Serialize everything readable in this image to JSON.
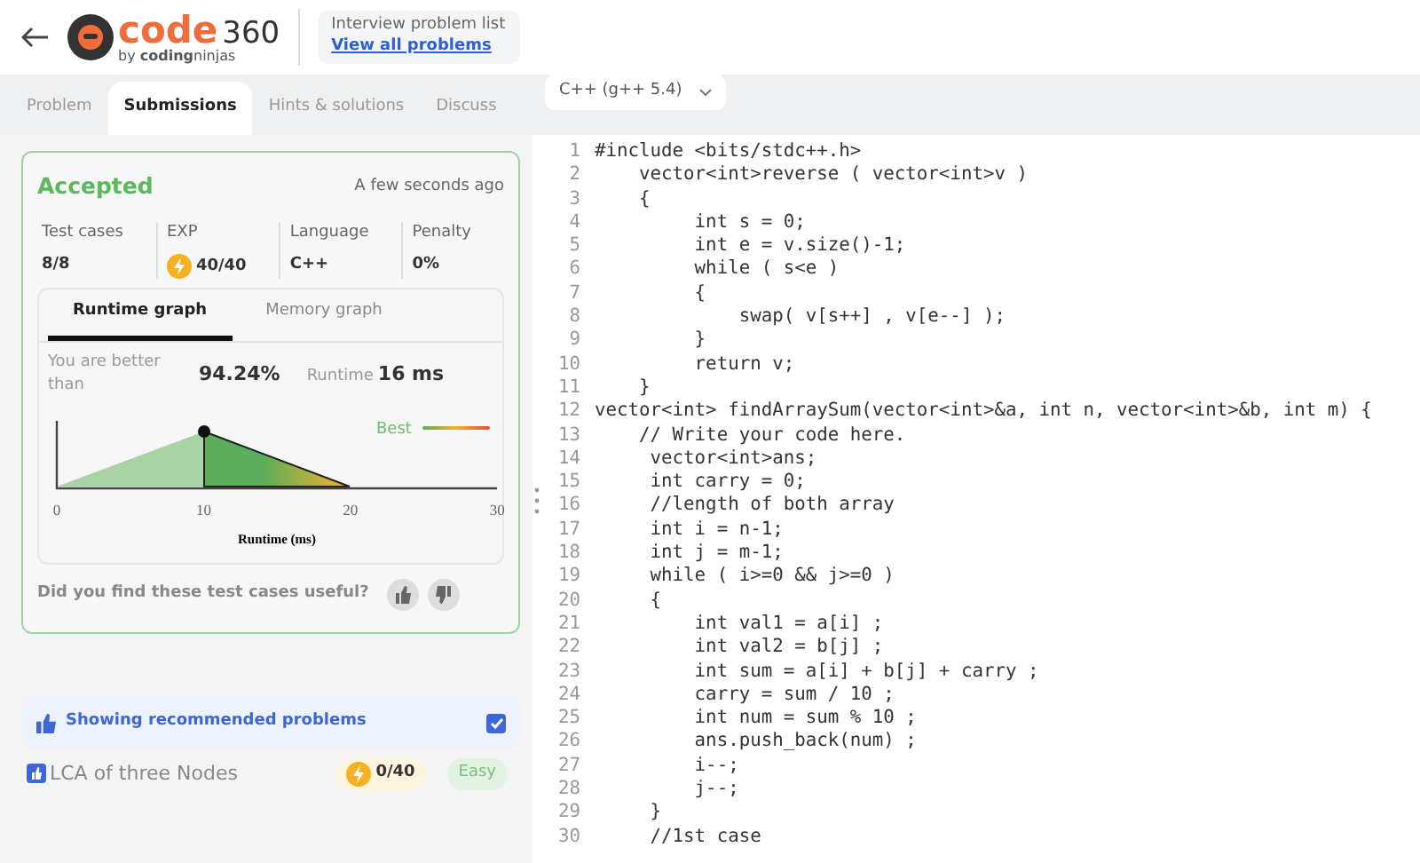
{
  "header": {
    "logo_word": "code",
    "logo_number": "360",
    "logo_by": "by",
    "logo_brand_bold": "coding",
    "logo_brand_light": "ninjas",
    "breadcrumb": "Interview problem list",
    "link": "View all problems"
  },
  "tabs": [
    {
      "label": "Problem",
      "selected": false
    },
    {
      "label": "Submissions",
      "selected": true
    },
    {
      "label": "Hints & solutions",
      "selected": false
    },
    {
      "label": "Discuss",
      "selected": false
    }
  ],
  "submission": {
    "status": "Accepted",
    "time": "A few seconds ago",
    "stats": [
      {
        "label": "Test cases",
        "value": "8/8",
        "kind": "plain"
      },
      {
        "label": "EXP",
        "value": "40/40",
        "kind": "exp"
      },
      {
        "label": "Language",
        "value": "C++",
        "kind": "plain"
      },
      {
        "label": "Penalty",
        "value": "0%",
        "kind": "plain"
      }
    ],
    "graph_tabs": [
      {
        "label": "Runtime graph",
        "selected": true
      },
      {
        "label": "Memory graph",
        "selected": false
      }
    ],
    "better_label": "You are better than",
    "better_value": "94.24%",
    "runtime_label": "Runtime",
    "runtime_value": "16 ms",
    "runtime_chart": {
      "legend": "Best",
      "xticks": [
        "0",
        "10",
        "20",
        "30"
      ],
      "xlabel": "Runtime (ms)"
    },
    "feedback": "Did you find these test cases useful?"
  },
  "recommended": {
    "label": "Showing recommended problems",
    "checked": true
  },
  "problems": [
    {
      "title": "LCA of three Nodes",
      "exp": "0/40",
      "difficulty": "Easy"
    }
  ],
  "editor": {
    "language": "C++ (g++ 5.4)",
    "lines": [
      {
        "number": "1",
        "text": "#include <bits/stdc++.h>"
      },
      {
        "number": "2",
        "text": "    vector<int>reverse ( vector<int>v )"
      },
      {
        "number": "3",
        "text": "    {"
      },
      {
        "number": "4",
        "text": "         int s = 0;"
      },
      {
        "number": "5",
        "text": "         int e = v.size()-1;"
      },
      {
        "number": "6",
        "text": "         while ( s<e )"
      },
      {
        "number": "7",
        "text": "         {"
      },
      {
        "number": "8",
        "text": "             swap( v[s++] , v[e--] );"
      },
      {
        "number": "9",
        "text": "         }"
      },
      {
        "number": "10",
        "text": "         return v;"
      },
      {
        "number": "11",
        "text": "    }"
      },
      {
        "number": "12",
        "text": "vector<int> findArraySum(vector<int>&a, int n, vector<int>&b, int m) {"
      },
      {
        "number": "13",
        "text": "    // Write your code here."
      },
      {
        "number": "14",
        "text": "     vector<int>ans;"
      },
      {
        "number": "15",
        "text": "     int carry = 0;"
      },
      {
        "number": "16",
        "text": "     //length of both array"
      },
      {
        "number": "17",
        "text": "     int i = n-1;"
      },
      {
        "number": "18",
        "text": "     int j = m-1;"
      },
      {
        "number": "19",
        "text": "     while ( i>=0 && j>=0 )"
      },
      {
        "number": "20",
        "text": "     {"
      },
      {
        "number": "21",
        "text": "         int val1 = a[i] ;"
      },
      {
        "number": "22",
        "text": "         int val2 = b[j] ;"
      },
      {
        "number": "23",
        "text": "         int sum = a[i] + b[j] + carry ;"
      },
      {
        "number": "24",
        "text": "         carry = sum / 10 ;"
      },
      {
        "number": "25",
        "text": "         int num = sum % 10 ;"
      },
      {
        "number": "26",
        "text": "         ans.push_back(num) ;"
      },
      {
        "number": "27",
        "text": "         i--;"
      },
      {
        "number": "28",
        "text": "         j--;"
      },
      {
        "number": "29",
        "text": "     }"
      },
      {
        "number": "30",
        "text": "     //1st case"
      }
    ]
  }
}
